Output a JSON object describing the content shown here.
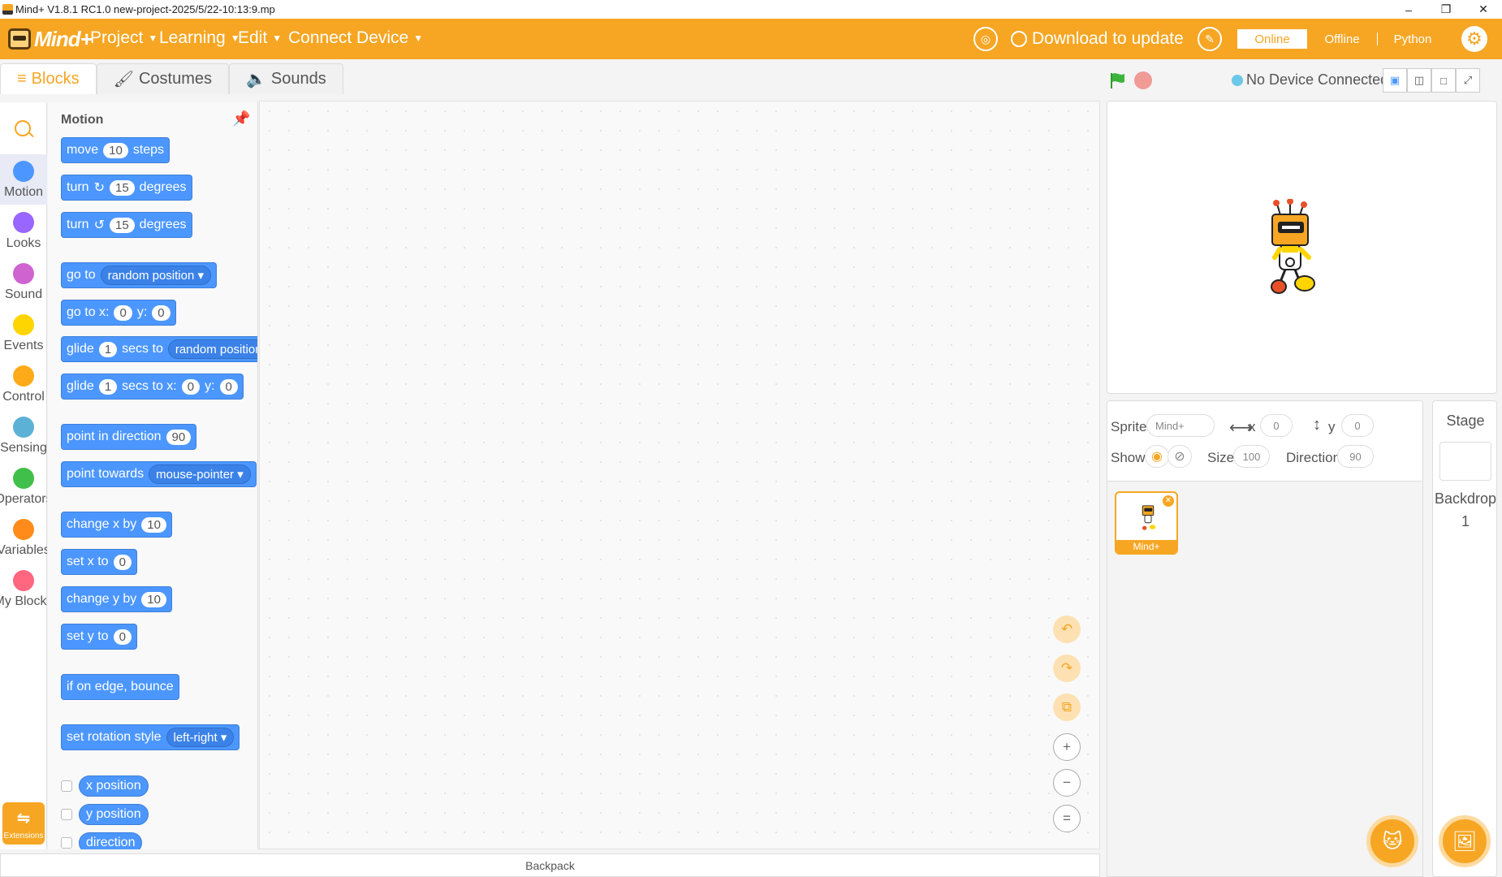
{
  "window": {
    "title": "Mind+ V1.8.1 RC1.0   new-project-2025/5/22-10:13:9.mp",
    "minimize": "–",
    "maximize": "❐",
    "close": "✕"
  },
  "menubar": {
    "logo": "Mind+",
    "menus": [
      "Project",
      "Learning",
      "Edit",
      "Connect Device"
    ],
    "download": "Download to update",
    "modes": {
      "online": "Online",
      "offline": "Offline",
      "python": "Python",
      "selected": "Online"
    },
    "accent": "#f6a623"
  },
  "tabs": {
    "blocks": "Blocks",
    "costumes": "Costumes",
    "sounds": "Sounds"
  },
  "stagebar": {
    "device_status": "No Device Connected"
  },
  "categories": [
    {
      "label": "Motion",
      "color": "#4c97ff"
    },
    {
      "label": "Looks",
      "color": "#9966ff"
    },
    {
      "label": "Sound",
      "color": "#cf63cf"
    },
    {
      "label": "Events",
      "color": "#ffd500"
    },
    {
      "label": "Control",
      "color": "#ffab19"
    },
    {
      "label": "Sensing",
      "color": "#5cb1d6"
    },
    {
      "label": "Operators",
      "color": "#40bf4a"
    },
    {
      "label": "Variables",
      "color": "#ff8c1a"
    },
    {
      "label": "My Blocks",
      "color": "#ff6680"
    }
  ],
  "extensions": "Extensions",
  "palette": {
    "title": "Motion",
    "move": {
      "a": "move",
      "n": "10",
      "b": "steps"
    },
    "turn_right": {
      "a": "turn",
      "n": "15",
      "b": "degrees"
    },
    "turn_left": {
      "a": "turn",
      "n": "15",
      "b": "degrees"
    },
    "goto": {
      "a": "go to",
      "d": "random position ▾"
    },
    "goto_xy": {
      "a": "go to x:",
      "x": "0",
      "b": "y:",
      "y": "0"
    },
    "glide_to": {
      "a": "glide",
      "n": "1",
      "b": "secs to",
      "d": "random position ▾"
    },
    "glide_xy": {
      "a": "glide",
      "n": "1",
      "b": "secs to x:",
      "x": "0",
      "c": "y:",
      "y": "0"
    },
    "point_dir": {
      "a": "point in direction",
      "n": "90"
    },
    "point_towards": {
      "a": "point towards",
      "d": "mouse-pointer ▾"
    },
    "change_x": {
      "a": "change x by",
      "n": "10"
    },
    "set_x": {
      "a": "set x to",
      "n": "0"
    },
    "change_y": {
      "a": "change y by",
      "n": "10"
    },
    "set_y": {
      "a": "set y to",
      "n": "0"
    },
    "bounce": "if on edge, bounce",
    "rotation": {
      "a": "set rotation style",
      "d": "left-right ▾"
    },
    "reporters": [
      "x position",
      "y position",
      "direction"
    ]
  },
  "backpack": "Backpack",
  "sprite_info": {
    "sprite_label": "Sprite",
    "sprite_name": "Mind+",
    "x_label": "x",
    "x": "0",
    "y_label": "y",
    "y": "0",
    "show_label": "Show",
    "size_label": "Size",
    "size": "100",
    "direction_label": "Direction",
    "direction": "90"
  },
  "sprite_list": [
    {
      "name": "Mind+"
    }
  ],
  "stage_panel": {
    "title": "Stage",
    "backdrop_label": "Backdrop",
    "backdrop_count": "1"
  }
}
